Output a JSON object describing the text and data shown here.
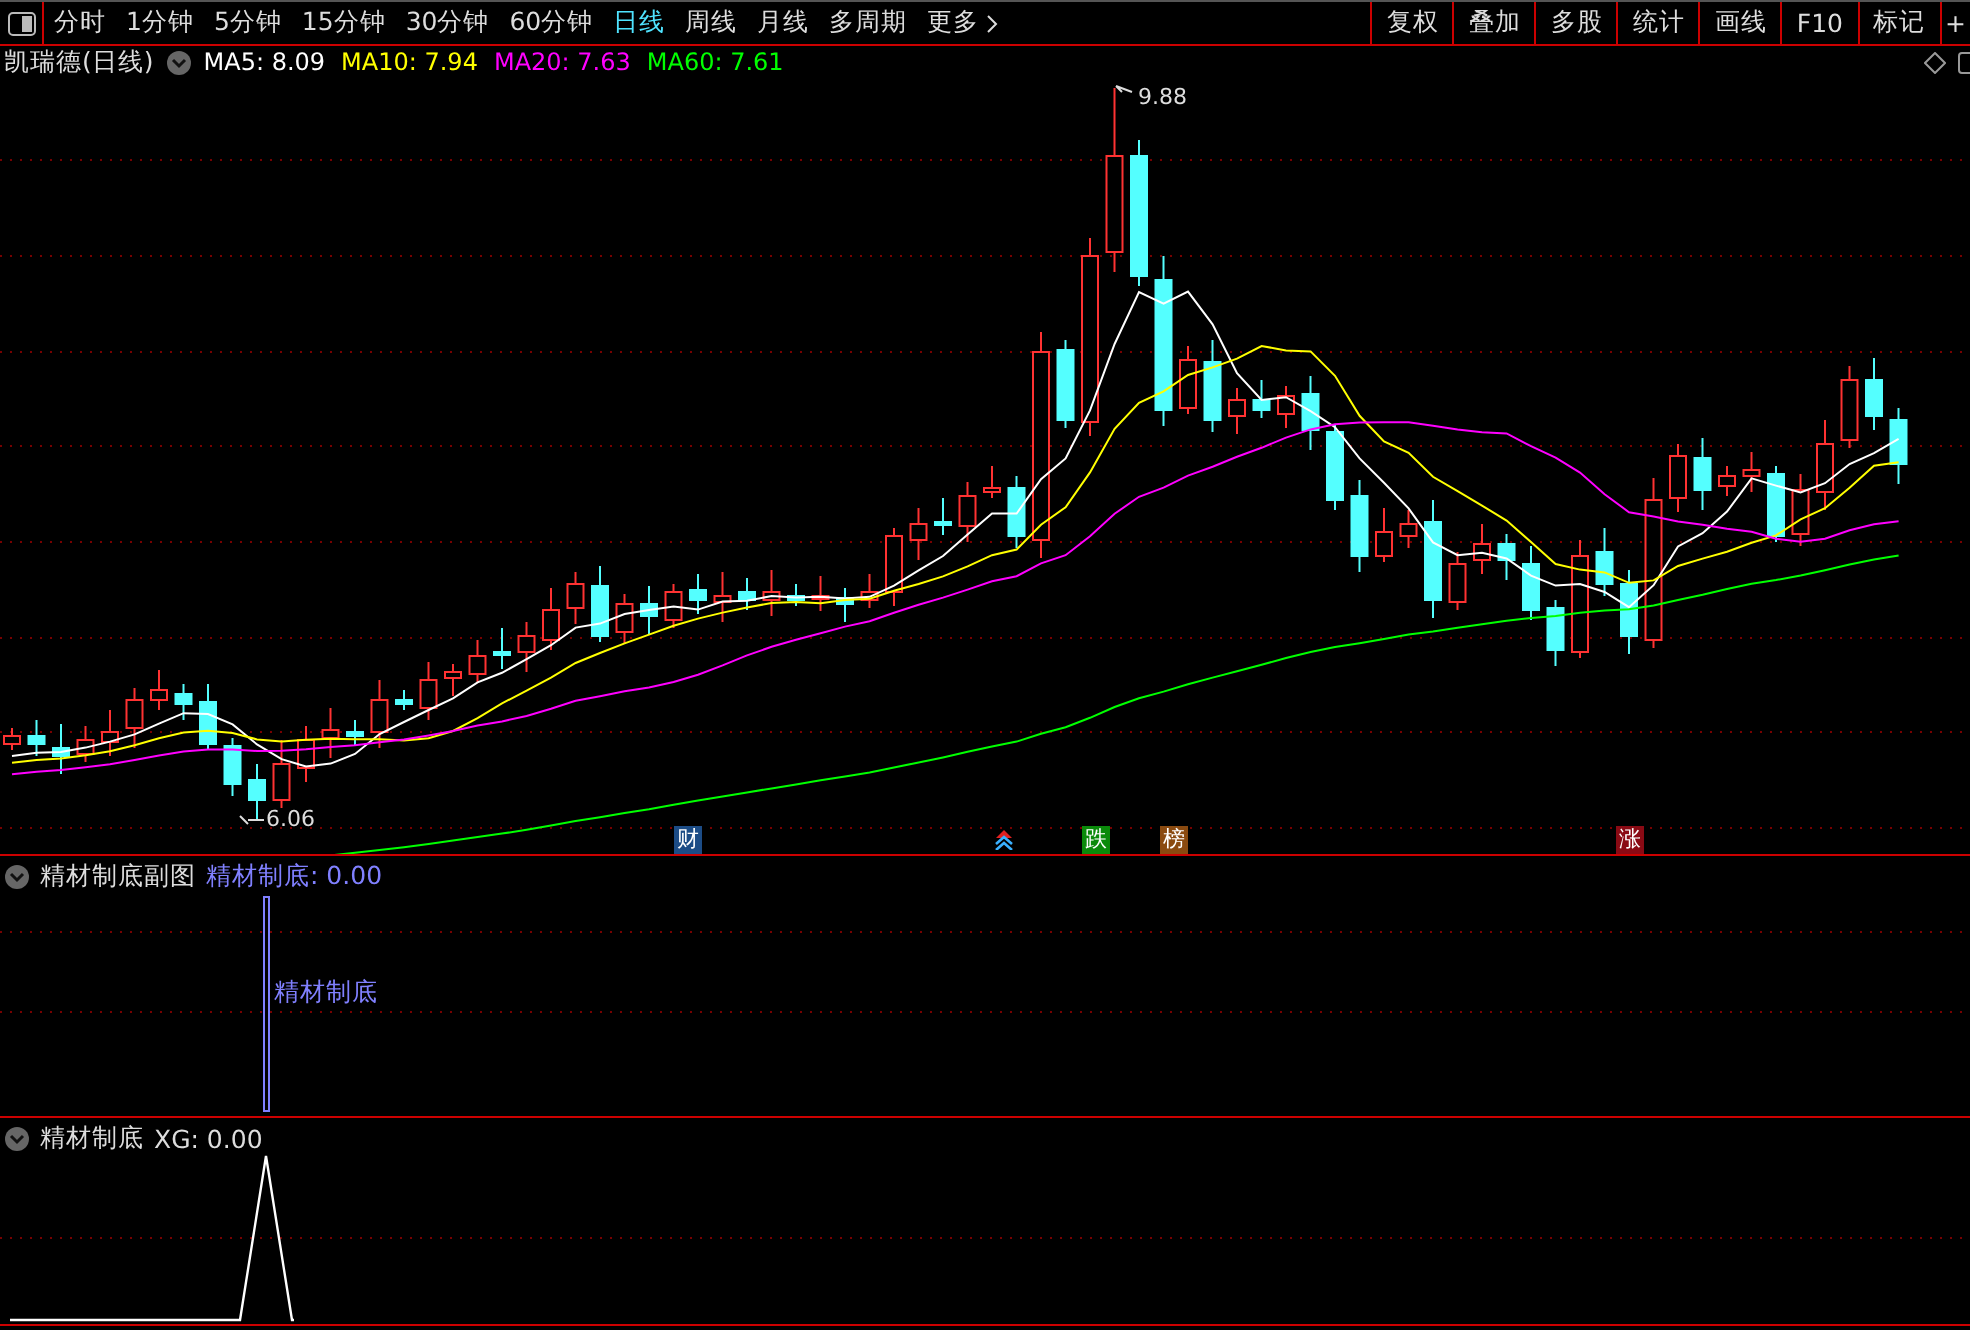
{
  "toolbar": {
    "periods": [
      {
        "label": "分时",
        "selected": false
      },
      {
        "label": "1分钟",
        "selected": false
      },
      {
        "label": "5分钟",
        "selected": false
      },
      {
        "label": "15分钟",
        "selected": false
      },
      {
        "label": "30分钟",
        "selected": false
      },
      {
        "label": "60分钟",
        "selected": false
      },
      {
        "label": "日线",
        "selected": true
      },
      {
        "label": "周线",
        "selected": false
      },
      {
        "label": "月线",
        "selected": false
      },
      {
        "label": "多周期",
        "selected": false
      },
      {
        "label": "更多",
        "selected": false
      }
    ],
    "tools": [
      "复权",
      "叠加",
      "多股",
      "统计",
      "画线",
      "F10",
      "标记",
      "+"
    ]
  },
  "main_panel": {
    "stock": "凯瑞德(日线)",
    "indicators": [
      {
        "name": "MA5: 8.09",
        "color": "#ffffff"
      },
      {
        "name": "MA10: 7.94",
        "color": "#ffff00"
      },
      {
        "name": "MA20: 7.63",
        "color": "#ff00ff"
      },
      {
        "name": "MA60: 7.61",
        "color": "#00ff00"
      }
    ],
    "high_label": "9.88",
    "low_label": "6.06",
    "markers": [
      {
        "kind": "text",
        "text": "财",
        "color": "#1c4c86"
      },
      {
        "kind": "arrow"
      },
      {
        "kind": "text",
        "text": "跌",
        "color": "#0a8a0a"
      },
      {
        "kind": "text",
        "text": "榜",
        "color": "#8a4a10"
      },
      {
        "kind": "text",
        "text": "涨",
        "color": "#8a0a14"
      }
    ]
  },
  "panels": [
    {
      "title": "精材制底副图",
      "readout": "精材制底: 0.00",
      "signal_label": "精材制底"
    },
    {
      "title": "精材制底",
      "readout": "XG: 0.00"
    }
  ]
}
